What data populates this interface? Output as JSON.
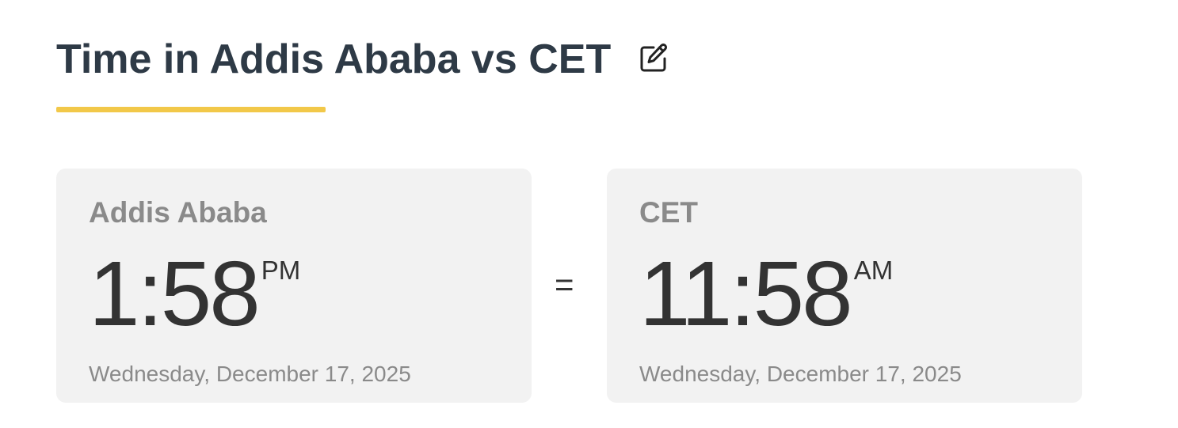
{
  "header": {
    "title": "Time in Addis Ababa vs CET",
    "edit_icon": "edit-pencil-icon",
    "accent_color": "#f2c849"
  },
  "comparison": {
    "left": {
      "zone": "Addis Ababa",
      "time": "1:58",
      "meridiem": "PM",
      "date": "Wednesday, December 17, 2025"
    },
    "separator": "=",
    "right": {
      "zone": "CET",
      "time": "11:58",
      "meridiem": "AM",
      "date": "Wednesday, December 17, 2025"
    }
  }
}
